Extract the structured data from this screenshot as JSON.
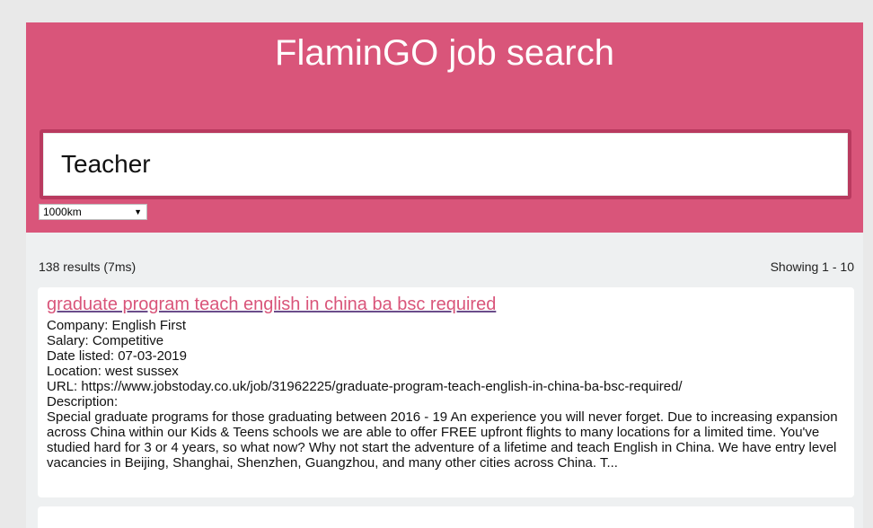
{
  "header": {
    "title": "FlaminGO job search"
  },
  "search": {
    "query": "Teacher",
    "radius_selected": "1000km"
  },
  "results": {
    "count_text": "138 results (7ms)",
    "showing_text": "Showing 1 - 10",
    "items": [
      {
        "title": "graduate program teach english in china ba bsc required",
        "company": "Company: English First",
        "salary": "Salary: Competitive",
        "date_listed": "Date listed: 07-03-2019",
        "location": "Location: west sussex",
        "url": "URL: https://www.jobstoday.co.uk/job/31962225/graduate-program-teach-english-in-china-ba-bsc-required/",
        "description_label": "Description:",
        "description": "Special graduate programs for those graduating between 2016 - 19 An experience you will never forget. Due to increasing expansion across China within our Kids & Teens schools we are able to offer FREE upfront flights to many locations for a limited time. You've studied hard for 3 or 4 years, so what now? Why not start the adventure of a lifetime and teach English in China. We have entry level vacancies in Beijing, Shanghai, Shenzhen, Guangzhou, and many other cities across China. T..."
      }
    ]
  },
  "colors": {
    "brand": "#d9557a",
    "brand_dark": "#b93a5f",
    "background": "#eef0f1"
  }
}
